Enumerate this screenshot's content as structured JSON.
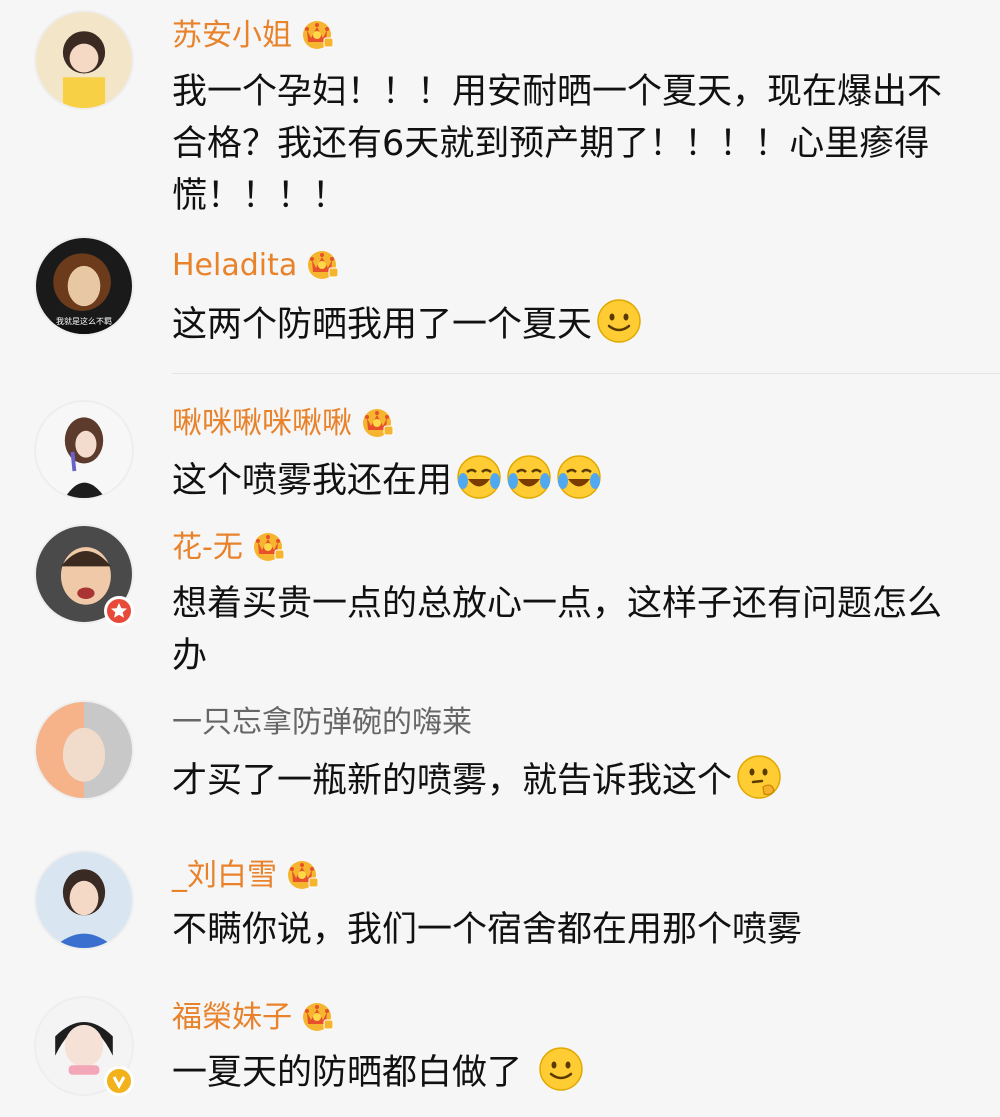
{
  "comments": [
    {
      "username": "苏安小姐",
      "text": "我一个孕妇！！！用安耐晒一个夏天，现在爆出不合格？我还有6天就到预产期了！！！！心里瘆得慌！！！！"
    },
    {
      "username": "Heladita",
      "text": "这两个防晒我用了一个夏天",
      "avatar_caption": "我就是这么不羁"
    },
    {
      "username": "啾咪啾咪啾啾",
      "text": "这个喷雾我还在用"
    },
    {
      "username": "花-无",
      "text": "想着买贵一点的总放心一点，这样子还有问题怎么办"
    },
    {
      "username": "一只忘拿防弹碗的嗨莱",
      "text": "才买了一瓶新的喷雾，就告诉我这个"
    },
    {
      "username": "_刘白雪",
      "text": "不瞒你说，我们一个宿舍都在用那个喷雾"
    },
    {
      "username": "福榮妹子",
      "text": "一夏天的防晒都白做了"
    }
  ],
  "icons": {
    "vip": "crown-icon",
    "smile": "smile-emoji-icon",
    "laugh_cry": "laugh-cry-emoji-icon",
    "thinking": "thinking-emoji-icon",
    "star_badge": "star-badge-icon",
    "verified_badge": "verified-badge-icon"
  },
  "colors": {
    "username_vip": "#e8822b",
    "username_normal": "#666666",
    "background": "#f6f6f6",
    "text": "#111111"
  }
}
